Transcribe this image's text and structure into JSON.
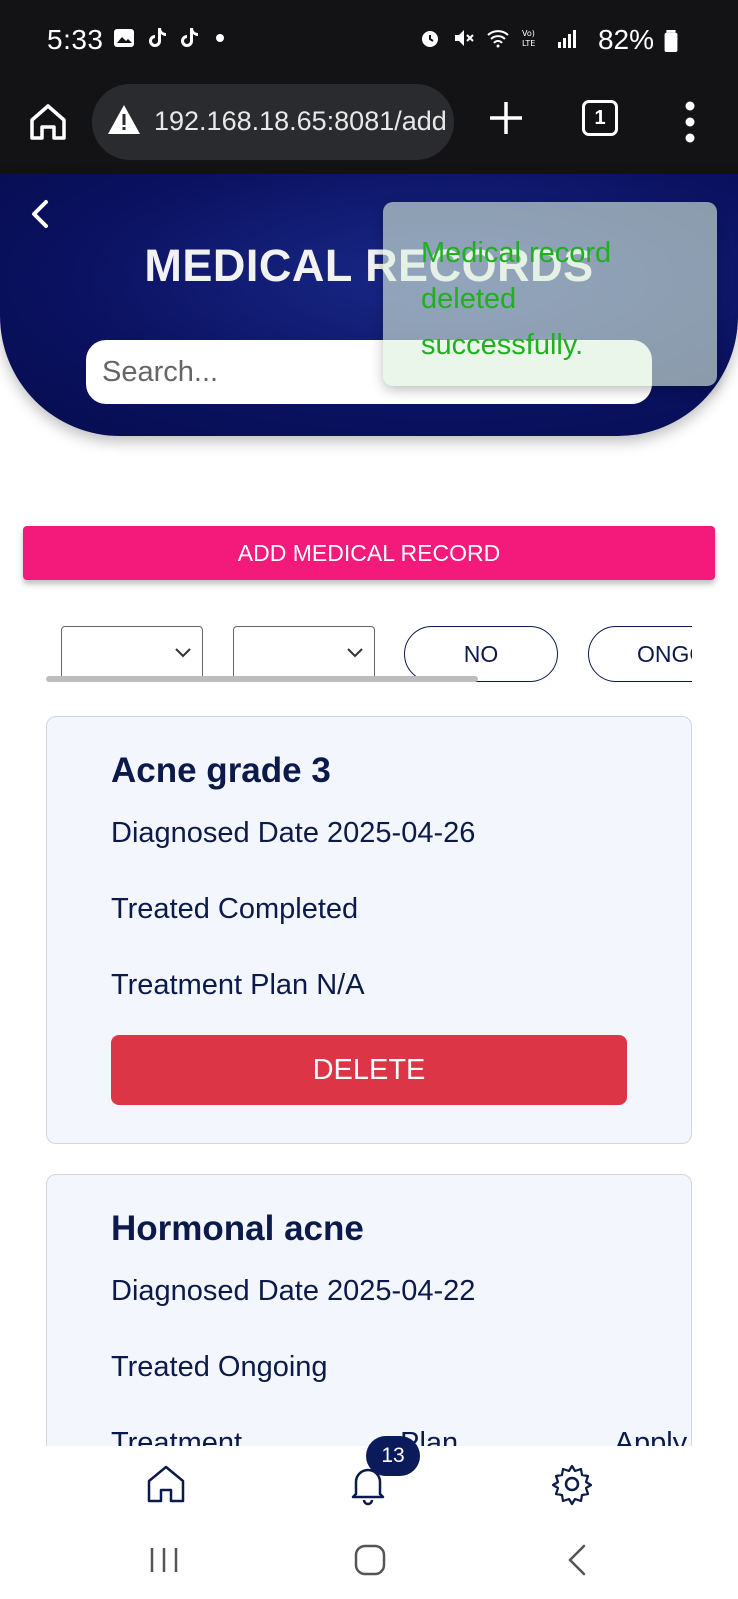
{
  "status_bar": {
    "time": "5:33",
    "battery_pct": "82%",
    "left_icons": [
      "image-icon",
      "tiktok-icon",
      "tiktok-icon",
      "dot-icon"
    ],
    "right_icons": [
      "alarm-icon",
      "mute-icon",
      "wifi-icon",
      "volte-icon",
      "signal-icon",
      "battery-icon"
    ]
  },
  "browser": {
    "url": "192.168.18.65:8081/add",
    "tab_count": "1"
  },
  "header": {
    "title": "MEDICAL RECORDS",
    "search_placeholder": "Search..."
  },
  "toast": {
    "message": "Medical record deleted successfully."
  },
  "actions": {
    "add_label": "ADD MEDICAL RECORD"
  },
  "filters": {
    "pills": [
      "NO",
      "ONGOING"
    ]
  },
  "records": [
    {
      "title": "Acne grade 3",
      "diagnosed": "Diagnosed Date 2025-04-26",
      "treated": "Treated Completed",
      "plan": "Treatment Plan N/A",
      "delete_label": "DELETE"
    },
    {
      "title": "Hormonal acne",
      "diagnosed": "Diagnosed Date 2025-04-22",
      "treated": "Treated Ongoing",
      "plan_partial": "Treatment Plan Apply"
    }
  ],
  "bottom_nav": {
    "notification_count": "13"
  },
  "colors": {
    "header_navy": "#0a1160",
    "accent_pink": "#f41a7c",
    "delete_red": "#dc3545",
    "toast_green": "#1db21d"
  }
}
